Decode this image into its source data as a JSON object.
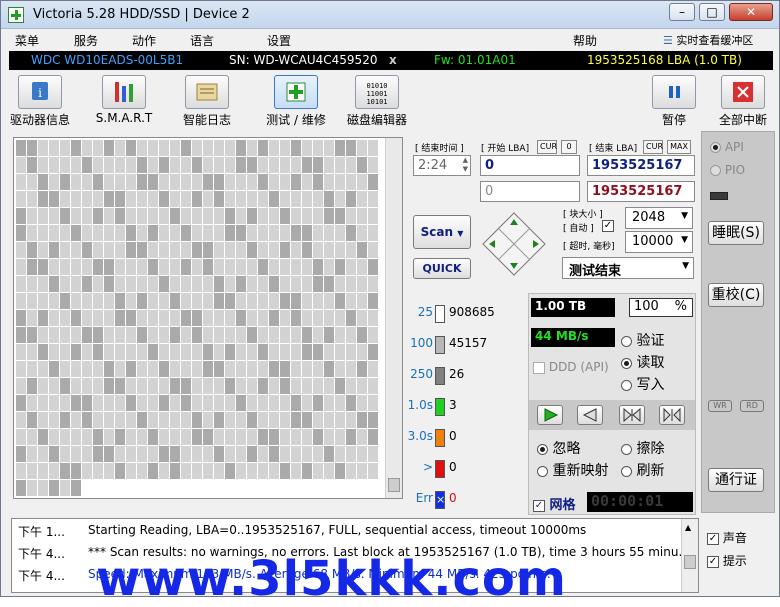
{
  "window": {
    "title": "Victoria 5.28 HDD/SSD | Device 2",
    "min": "–",
    "max": "□",
    "close": "✕"
  },
  "menu": {
    "items": [
      "菜单",
      "服务",
      "动作",
      "语言",
      "设置",
      "帮助"
    ],
    "realtime_label": "实时查看缓冲区"
  },
  "info": {
    "model": "WDC WD10EADS-00L5B1",
    "serial": "SN: WD-WCAU4C459520",
    "x": "x",
    "firmware": "Fw: 01.01A01",
    "lba": "1953525168 LBA (1.0 TB)"
  },
  "toolbar": {
    "drive_info": "驱动器信息",
    "smart": "S.M.A.R.T",
    "smart_log": "智能日志",
    "test": "测试 / 维修",
    "disk_editor": "磁盘编辑器",
    "pause": "暂停",
    "stop_all": "全部中断"
  },
  "params": {
    "end_time_label": "[ 结束时间 ]",
    "end_time": "2:24",
    "start_lba_label": "[ 开始 LBA]",
    "cur_label": "CUR",
    "zero_label": "0",
    "start_lba": "0",
    "start_lba2": "0",
    "end_lba_label": "[ 结束 LBA]",
    "max_label": "MAX",
    "end_lba": "1953525167",
    "end_lba2": "1953525167",
    "block_size_label": "[ 块大小 ]",
    "auto_label": "[ 自动 ]",
    "block_size": "2048",
    "timeout_label": "[ 超时, 毫秒]",
    "timeout": "10000",
    "scan_button": "Scan",
    "quick_button": "QUICK",
    "status_select": "测试结束"
  },
  "stats": [
    {
      "k": "25",
      "color": "#ffffff",
      "v": "908685"
    },
    {
      "k": "100",
      "color": "#b8b8b8",
      "v": "45157"
    },
    {
      "k": "250",
      "color": "#808080",
      "v": "26"
    },
    {
      "k": "1.0s",
      "color": "#20d020",
      "v": "3"
    },
    {
      "k": "3.0s",
      "color": "#f08010",
      "v": "0"
    },
    {
      "k": ">",
      "color": "#e01010",
      "v": "0"
    },
    {
      "k": "Err",
      "color": "#1030e0",
      "v": "0"
    }
  ],
  "progress": {
    "size": "1.00 TB",
    "percent": "100",
    "percent_sign": "%",
    "speed": "44 MB/s",
    "ddd_label": "DDD (API)"
  },
  "mode": {
    "verify": "验证",
    "read": "读取",
    "write": "写入"
  },
  "action": {
    "ignore": "忽略",
    "erase": "擦除",
    "remap": "重新映射",
    "refresh": "刷新"
  },
  "grid_toggle": {
    "label": "网格",
    "timer": "00:00:01"
  },
  "side": {
    "api": "API",
    "pio": "PIO",
    "sleep": "睡眠(S)",
    "recal": "重校(C)",
    "wr": "WR",
    "rd": "RD",
    "passport": "通行证"
  },
  "options": {
    "sound": "声音",
    "hints": "提示"
  },
  "log": [
    {
      "time": "下午 1...",
      "msg": "Starting Reading, LBA=0..1953525167, FULL, sequential access, timeout 10000ms"
    },
    {
      "time": "下午 4...",
      "msg": "*** Scan results: no warnings, no errors. Last block at 1953525167 (1.0 TB), time 3 hours 55 minu..."
    },
    {
      "time": "下午 4...",
      "msg": "Speed: Maximum 113 MB/s. Average 68 MB/s. Minimum 44 MB/s. 423 points."
    }
  ],
  "watermark": "www.3l5kkk.com"
}
